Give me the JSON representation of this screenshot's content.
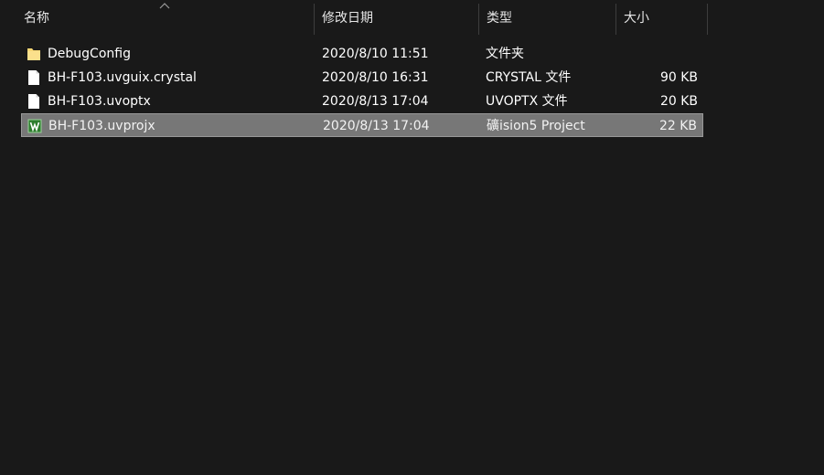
{
  "columns": {
    "name": "名称",
    "date": "修改日期",
    "type": "类型",
    "size": "大小"
  },
  "files": [
    {
      "name": "DebugConfig",
      "date": "2020/8/10 11:51",
      "type": "文件夹",
      "size": "",
      "icon": "folder-icon",
      "selected": false
    },
    {
      "name": "BH-F103.uvguix.crystal",
      "date": "2020/8/10 16:31",
      "type": "CRYSTAL 文件",
      "size": "90 KB",
      "icon": "file-icon",
      "selected": false
    },
    {
      "name": "BH-F103.uvoptx",
      "date": "2020/8/13 17:04",
      "type": "UVOPTX 文件",
      "size": "20 KB",
      "icon": "file-icon",
      "selected": false
    },
    {
      "name": "BH-F103.uvprojx",
      "date": "2020/8/13 17:04",
      "type": "礦ision5 Project",
      "size": "22 KB",
      "icon": "keil-project-icon",
      "selected": true
    }
  ],
  "colors": {
    "background": "#191919",
    "selection": "#777777",
    "folder": "#f8d775"
  }
}
